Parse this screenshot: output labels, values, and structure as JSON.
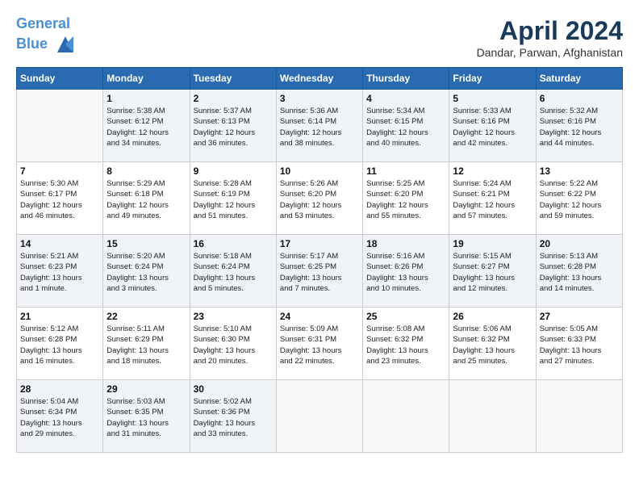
{
  "header": {
    "logo_line1": "General",
    "logo_line2": "Blue",
    "month_year": "April 2024",
    "location": "Dandar, Parwan, Afghanistan"
  },
  "days_of_week": [
    "Sunday",
    "Monday",
    "Tuesday",
    "Wednesday",
    "Thursday",
    "Friday",
    "Saturday"
  ],
  "weeks": [
    [
      {
        "day": "",
        "info": ""
      },
      {
        "day": "1",
        "info": "Sunrise: 5:38 AM\nSunset: 6:12 PM\nDaylight: 12 hours\nand 34 minutes."
      },
      {
        "day": "2",
        "info": "Sunrise: 5:37 AM\nSunset: 6:13 PM\nDaylight: 12 hours\nand 36 minutes."
      },
      {
        "day": "3",
        "info": "Sunrise: 5:36 AM\nSunset: 6:14 PM\nDaylight: 12 hours\nand 38 minutes."
      },
      {
        "day": "4",
        "info": "Sunrise: 5:34 AM\nSunset: 6:15 PM\nDaylight: 12 hours\nand 40 minutes."
      },
      {
        "day": "5",
        "info": "Sunrise: 5:33 AM\nSunset: 6:16 PM\nDaylight: 12 hours\nand 42 minutes."
      },
      {
        "day": "6",
        "info": "Sunrise: 5:32 AM\nSunset: 6:16 PM\nDaylight: 12 hours\nand 44 minutes."
      }
    ],
    [
      {
        "day": "7",
        "info": "Sunrise: 5:30 AM\nSunset: 6:17 PM\nDaylight: 12 hours\nand 46 minutes."
      },
      {
        "day": "8",
        "info": "Sunrise: 5:29 AM\nSunset: 6:18 PM\nDaylight: 12 hours\nand 49 minutes."
      },
      {
        "day": "9",
        "info": "Sunrise: 5:28 AM\nSunset: 6:19 PM\nDaylight: 12 hours\nand 51 minutes."
      },
      {
        "day": "10",
        "info": "Sunrise: 5:26 AM\nSunset: 6:20 PM\nDaylight: 12 hours\nand 53 minutes."
      },
      {
        "day": "11",
        "info": "Sunrise: 5:25 AM\nSunset: 6:20 PM\nDaylight: 12 hours\nand 55 minutes."
      },
      {
        "day": "12",
        "info": "Sunrise: 5:24 AM\nSunset: 6:21 PM\nDaylight: 12 hours\nand 57 minutes."
      },
      {
        "day": "13",
        "info": "Sunrise: 5:22 AM\nSunset: 6:22 PM\nDaylight: 12 hours\nand 59 minutes."
      }
    ],
    [
      {
        "day": "14",
        "info": "Sunrise: 5:21 AM\nSunset: 6:23 PM\nDaylight: 13 hours\nand 1 minute."
      },
      {
        "day": "15",
        "info": "Sunrise: 5:20 AM\nSunset: 6:24 PM\nDaylight: 13 hours\nand 3 minutes."
      },
      {
        "day": "16",
        "info": "Sunrise: 5:18 AM\nSunset: 6:24 PM\nDaylight: 13 hours\nand 5 minutes."
      },
      {
        "day": "17",
        "info": "Sunrise: 5:17 AM\nSunset: 6:25 PM\nDaylight: 13 hours\nand 7 minutes."
      },
      {
        "day": "18",
        "info": "Sunrise: 5:16 AM\nSunset: 6:26 PM\nDaylight: 13 hours\nand 10 minutes."
      },
      {
        "day": "19",
        "info": "Sunrise: 5:15 AM\nSunset: 6:27 PM\nDaylight: 13 hours\nand 12 minutes."
      },
      {
        "day": "20",
        "info": "Sunrise: 5:13 AM\nSunset: 6:28 PM\nDaylight: 13 hours\nand 14 minutes."
      }
    ],
    [
      {
        "day": "21",
        "info": "Sunrise: 5:12 AM\nSunset: 6:28 PM\nDaylight: 13 hours\nand 16 minutes."
      },
      {
        "day": "22",
        "info": "Sunrise: 5:11 AM\nSunset: 6:29 PM\nDaylight: 13 hours\nand 18 minutes."
      },
      {
        "day": "23",
        "info": "Sunrise: 5:10 AM\nSunset: 6:30 PM\nDaylight: 13 hours\nand 20 minutes."
      },
      {
        "day": "24",
        "info": "Sunrise: 5:09 AM\nSunset: 6:31 PM\nDaylight: 13 hours\nand 22 minutes."
      },
      {
        "day": "25",
        "info": "Sunrise: 5:08 AM\nSunset: 6:32 PM\nDaylight: 13 hours\nand 23 minutes."
      },
      {
        "day": "26",
        "info": "Sunrise: 5:06 AM\nSunset: 6:32 PM\nDaylight: 13 hours\nand 25 minutes."
      },
      {
        "day": "27",
        "info": "Sunrise: 5:05 AM\nSunset: 6:33 PM\nDaylight: 13 hours\nand 27 minutes."
      }
    ],
    [
      {
        "day": "28",
        "info": "Sunrise: 5:04 AM\nSunset: 6:34 PM\nDaylight: 13 hours\nand 29 minutes."
      },
      {
        "day": "29",
        "info": "Sunrise: 5:03 AM\nSunset: 6:35 PM\nDaylight: 13 hours\nand 31 minutes."
      },
      {
        "day": "30",
        "info": "Sunrise: 5:02 AM\nSunset: 6:36 PM\nDaylight: 13 hours\nand 33 minutes."
      },
      {
        "day": "",
        "info": ""
      },
      {
        "day": "",
        "info": ""
      },
      {
        "day": "",
        "info": ""
      },
      {
        "day": "",
        "info": ""
      }
    ]
  ]
}
